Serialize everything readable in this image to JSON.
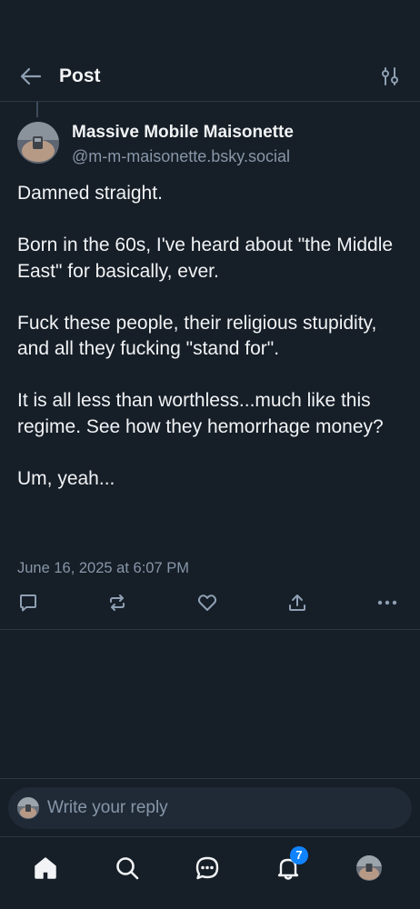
{
  "header": {
    "title": "Post",
    "back_icon": "arrow-left-icon",
    "filter_icon": "sliders-icon"
  },
  "post": {
    "author_name": "Massive Mobile Maisonette",
    "author_handle": "@m-m-maisonette.bsky.social",
    "paragraphs": [
      "Damned straight.",
      "Born in the 60s, I've heard about \"the Middle East\" for basically, ever.",
      "Fuck these people, their religious stupidity, and all they fucking \"stand for\".",
      "It is all less than worthless...much like this regime.  See how they hemorrhage money?",
      "Um, yeah..."
    ],
    "timestamp": "June 16, 2025 at 6:07 PM"
  },
  "actions": {
    "reply_icon": "reply-icon",
    "repost_icon": "repost-icon",
    "like_icon": "heart-icon",
    "share_icon": "share-icon",
    "more_icon": "more-icon"
  },
  "composer": {
    "placeholder": "Write your reply"
  },
  "tabbar": {
    "home_icon": "home-icon",
    "search_icon": "search-icon",
    "chat_icon": "chat-icon",
    "notifications_icon": "bell-icon",
    "notification_count": "7"
  },
  "colors": {
    "background": "#161e27",
    "text": "#f1f3f5",
    "muted": "#8796a8",
    "accent": "#1083fe",
    "divider": "#2b3744"
  }
}
